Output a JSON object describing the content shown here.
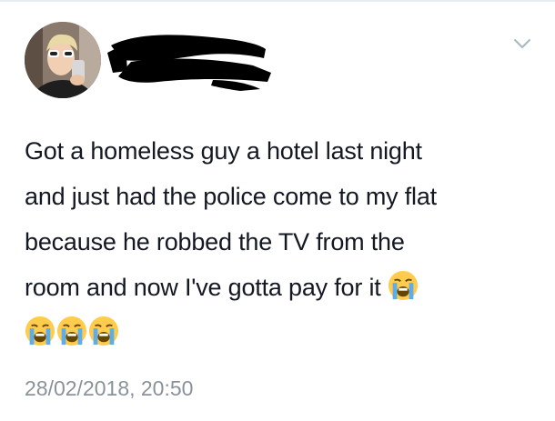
{
  "tweet": {
    "lines": [
      "Got a homeless guy a hotel last night",
      "and just had the police come to my flat",
      "because he robbed the TV from the",
      "room and now I've gotta pay for it"
    ],
    "emojis": [
      "loudly-crying-face",
      "loudly-crying-face",
      "loudly-crying-face",
      "loudly-crying-face"
    ],
    "timestamp": "28/02/2018, 20:50"
  },
  "icons": {
    "menu": "chevron-down-icon"
  },
  "colors": {
    "text": "#141823",
    "muted": "#8a9299",
    "divider": "#e6ecf0",
    "emoji_face": "#FFCC4D",
    "tears": "#5DADEC"
  }
}
